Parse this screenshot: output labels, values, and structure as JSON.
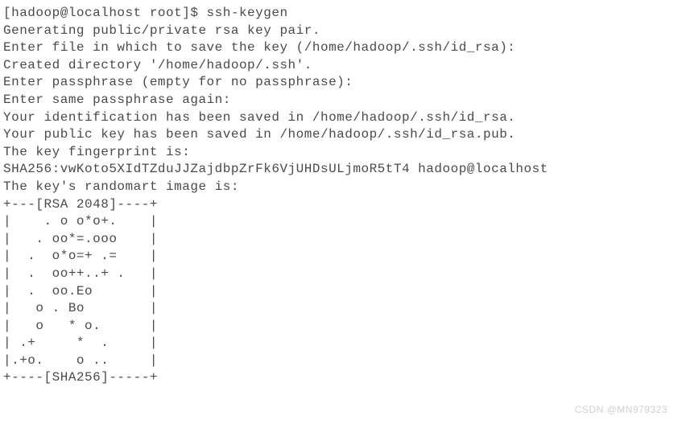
{
  "terminal": {
    "lines": {
      "l0": "[hadoop@localhost root]$ ssh-keygen",
      "l1": "Generating public/private rsa key pair.",
      "l2": "Enter file in which to save the key (/home/hadoop/.ssh/id_rsa):",
      "l3": "Created directory '/home/hadoop/.ssh'.",
      "l4": "Enter passphrase (empty for no passphrase):",
      "l5": "Enter same passphrase again:",
      "l6": "Your identification has been saved in /home/hadoop/.ssh/id_rsa.",
      "l7": "Your public key has been saved in /home/hadoop/.ssh/id_rsa.pub.",
      "l8": "The key fingerprint is:",
      "l9": "SHA256:vwKoto5XIdTZduJJZajdbpZrFk6VjUHDsULjmoR5tT4 hadoop@localhost",
      "l10": "The key's randomart image is:",
      "l11": "+---[RSA 2048]----+",
      "l12": "|    . o o*o+.    |",
      "l13": "|   . oo*=.ooo    |",
      "l14": "|  .  o*o=+ .=    |",
      "l15": "|  .  oo++..+ .   |",
      "l16": "|  .  oo.Eo       |",
      "l17": "|   o . Bo        |",
      "l18": "|   o   * o.      |",
      "l19": "| .+     *  .     |",
      "l20": "|.+o.    o ..     |",
      "l21": "+----[SHA256]-----+"
    }
  },
  "watermark": {
    "text": "CSDN @MN979323"
  }
}
